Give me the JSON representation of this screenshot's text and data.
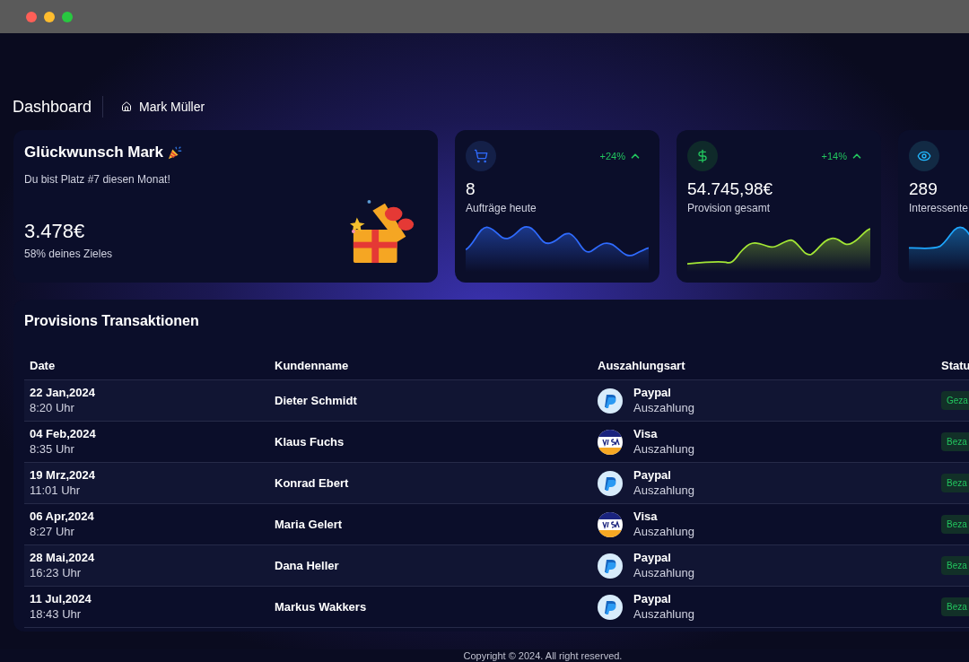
{
  "header": {
    "title": "Dashboard",
    "breadcrumb": "Mark Müller"
  },
  "welcome": {
    "title": "Glückwunsch Mark",
    "subtitle": "Du bist Platz #7 diesen Monat!",
    "amount": "3.478€",
    "goal": "58% deines Zieles"
  },
  "stats": [
    {
      "kind": "cart",
      "value": "8",
      "label": "Aufträge heute",
      "trend": "+24%",
      "color": "#2f6bff"
    },
    {
      "kind": "dollar",
      "value": "54.745,98€",
      "label": "Provision gesamt",
      "trend": "+14%",
      "color": "#a3e635"
    },
    {
      "kind": "eye",
      "value": "289",
      "label": "Interessente",
      "color": "#1ea7ff"
    }
  ],
  "table": {
    "title": "Provisions Transaktionen",
    "columns": [
      "Date",
      "Kundenname",
      "Auszahlungsart",
      "Statu"
    ],
    "rows": [
      {
        "date": "22 Jan,2024",
        "time": "8:20 Uhr",
        "name": "Dieter Schmidt",
        "kind": "paypal",
        "method": "Paypal",
        "type": "Auszahlung",
        "status": "Geza"
      },
      {
        "date": "04 Feb,2024",
        "time": "8:35 Uhr",
        "name": "Klaus Fuchs",
        "kind": "visa",
        "method": "Visa",
        "type": "Auszahlung",
        "status": "Beza"
      },
      {
        "date": "19 Mrz,2024",
        "time": "11:01 Uhr",
        "name": "Konrad Ebert",
        "kind": "paypal",
        "method": "Paypal",
        "type": "Auszahlung",
        "status": "Beza"
      },
      {
        "date": "06 Apr,2024",
        "time": "8:27 Uhr",
        "name": "Maria Gelert",
        "kind": "visa",
        "method": "Visa",
        "type": "Auszahlung",
        "status": "Beza"
      },
      {
        "date": "28 Mai,2024",
        "time": "16:23 Uhr",
        "name": "Dana Heller",
        "kind": "paypal",
        "method": "Paypal",
        "type": "Auszahlung",
        "status": "Beza"
      },
      {
        "date": "11 Jul,2024",
        "time": "18:43 Uhr",
        "name": "Markus Wakkers",
        "kind": "paypal",
        "method": "Paypal",
        "type": "Auszahlung",
        "status": "Beza"
      }
    ]
  },
  "footer": "Copyright © 2024. All right reserved."
}
